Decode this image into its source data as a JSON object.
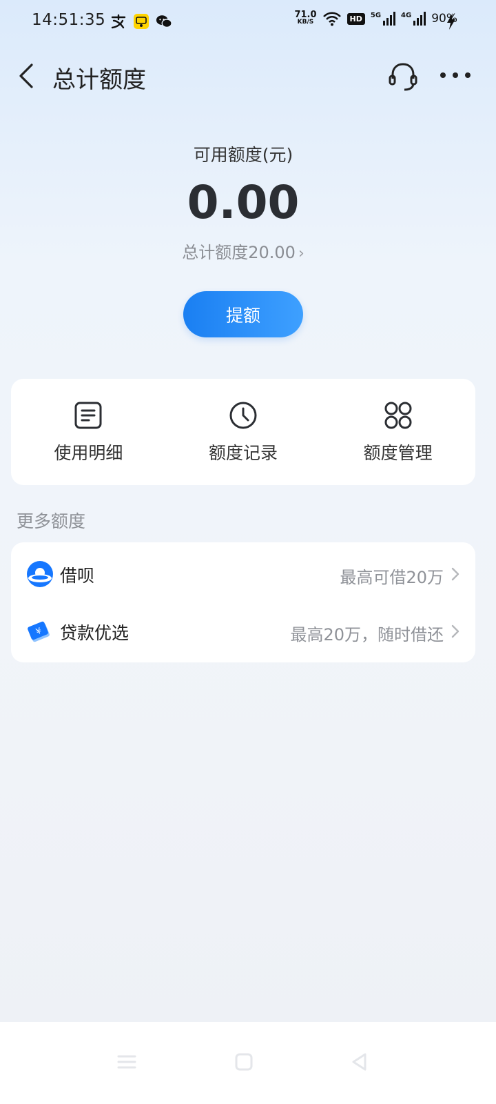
{
  "status_bar": {
    "time": "14:51:35",
    "net_speed_value": "71.0",
    "net_speed_unit": "KB/S",
    "hd": "HD",
    "sig1_label": "5G",
    "sig2_label": "4G",
    "battery": "90%",
    "app_icons": [
      "alipay-notification-icon",
      "xianyu-app-icon",
      "wechat-icon"
    ]
  },
  "header": {
    "title": "总计额度"
  },
  "balance": {
    "label": "可用额度(元)",
    "amount": "0.00",
    "total_limit": "总计额度20.00",
    "raise_button": "提额"
  },
  "actions": [
    {
      "label": "使用明细",
      "icon": "list-doc-icon"
    },
    {
      "label": "额度记录",
      "icon": "clock-icon"
    },
    {
      "label": "额度管理",
      "icon": "grid-icon"
    }
  ],
  "more_credit": {
    "title": "更多额度",
    "items": [
      {
        "title": "借呗",
        "desc": "最高可借20万",
        "icon": "jiebei-icon"
      },
      {
        "title": "贷款优选",
        "desc": "最高20万，随时借还",
        "icon": "loan-ticket-icon"
      }
    ]
  },
  "colors": {
    "accent": "#1a7ff2",
    "background_top": "#dbeafb",
    "card": "#ffffff",
    "muted_text": "#8f9298"
  }
}
